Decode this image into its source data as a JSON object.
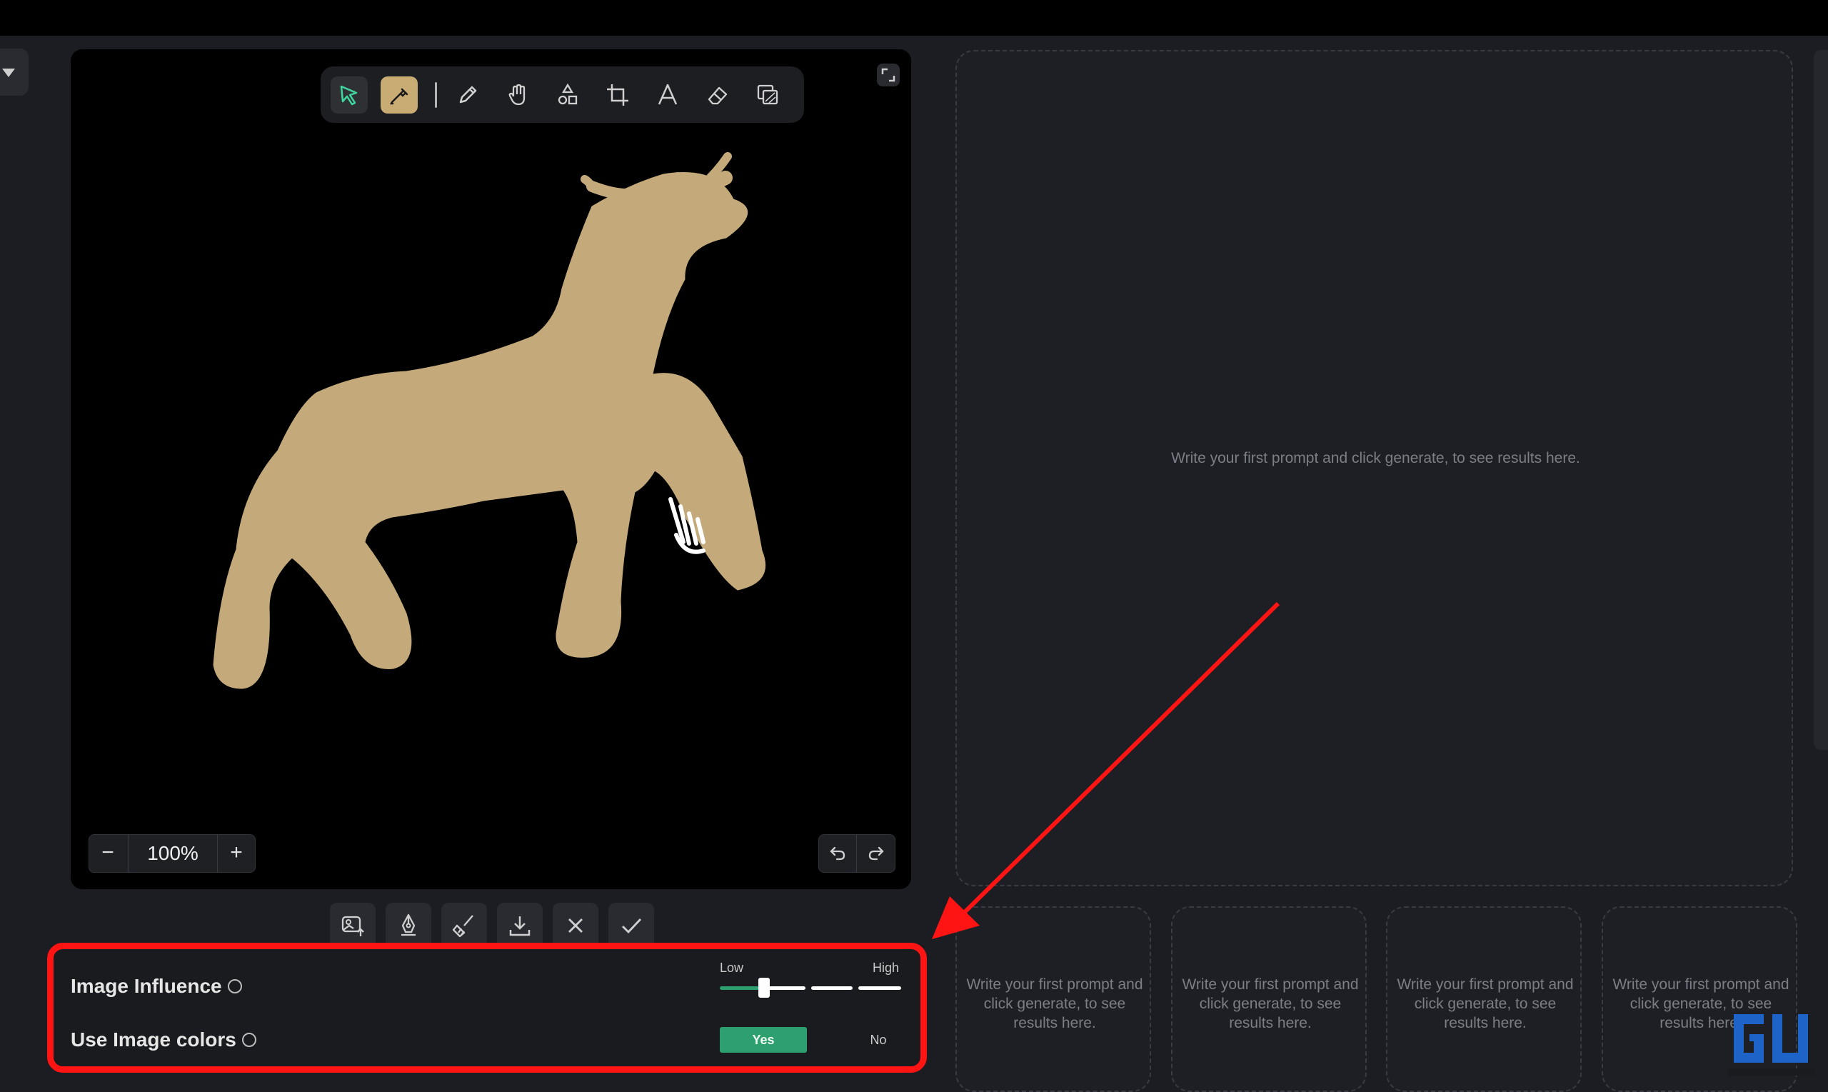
{
  "canvas": {
    "zoom_level": "100%",
    "tools": [
      "select-icon",
      "eyedropper-icon",
      "pencil-icon",
      "hand-icon",
      "shapes-icon",
      "crop-icon",
      "text-icon",
      "eraser-icon",
      "layers-icon"
    ],
    "active_tools": [
      "select",
      "eyedropper"
    ],
    "sketch_color": "#c4a97a"
  },
  "actions": [
    "image-upload-icon",
    "pen-tool-icon",
    "brush-icon",
    "download-icon",
    "close-icon",
    "check-icon"
  ],
  "settings": {
    "image_influence": {
      "label": "Image Influence",
      "low_label": "Low",
      "high_label": "High",
      "level": 0.25,
      "steps": 4
    },
    "use_image_colors": {
      "label": "Use Image colors",
      "yes_label": "Yes",
      "no_label": "No",
      "selected": "Yes"
    }
  },
  "results": {
    "main_placeholder": "Write your first prompt and click generate, to see results here.",
    "thumb_placeholders": [
      "Write your first prompt and click generate, to see results here.",
      "Write your first prompt and click generate, to see results here.",
      "Write your first prompt and click generate, to see results here.",
      "Write your first prompt and click generate, to see results here."
    ]
  },
  "colors": {
    "accent_green": "#2e9f6f",
    "highlight_red": "#ff1414",
    "eyedropper_active": "#c9ac73"
  }
}
